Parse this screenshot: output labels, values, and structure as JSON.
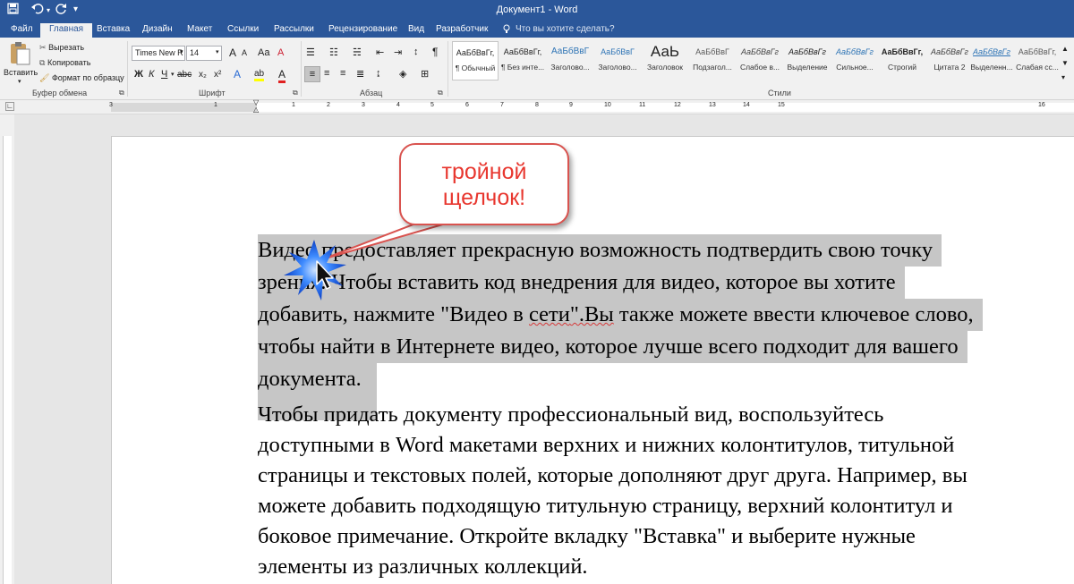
{
  "window": {
    "title": "Документ1 - Word"
  },
  "tabs": [
    "Файл",
    "Главная",
    "Вставка",
    "Дизайн",
    "Макет",
    "Ссылки",
    "Рассылки",
    "Рецензирование",
    "Вид",
    "Разработчик"
  ],
  "tell_me": "Что вы хотите сделать?",
  "clipboard": {
    "paste": "Вставить",
    "cut": "Вырезать",
    "copy": "Копировать",
    "format_painter": "Формат по образцу",
    "group": "Буфер обмена"
  },
  "font": {
    "name": "Times New R",
    "size": "14",
    "group": "Шрифт",
    "bold": "Ж",
    "italic": "К",
    "underline": "Ч",
    "strike": "abc",
    "sub": "x₂",
    "sup": "x²",
    "grow": "A",
    "shrink": "A",
    "case": "Aa",
    "clear": "A",
    "effects": "A",
    "highlight": "ab",
    "color": "A"
  },
  "paragraph": {
    "group": "Абзац",
    "pilcrow": "¶"
  },
  "styles": {
    "group": "Стили",
    "items": [
      {
        "preview": "АаБбВвГг,",
        "name": "¶ Обычный"
      },
      {
        "preview": "АаБбВвГг,",
        "name": "¶ Без инте..."
      },
      {
        "preview": "АаБбВвГ",
        "name": "Заголово..."
      },
      {
        "preview": "АаБбВвГ",
        "name": "Заголово..."
      },
      {
        "preview": "АаЬ",
        "name": "Заголовок"
      },
      {
        "preview": "АаБбВвГ",
        "name": "Подзагол..."
      },
      {
        "preview": "АаБбВвГг",
        "name": "Слабое в..."
      },
      {
        "preview": "АаБбВвГг",
        "name": "Выделение"
      },
      {
        "preview": "АаБбВвГг",
        "name": "Сильное..."
      },
      {
        "preview": "АаБбВвГг,",
        "name": "Строгий"
      },
      {
        "preview": "АаБбВвГг",
        "name": "Цитата 2"
      },
      {
        "preview": "АаБбВвГг",
        "name": "Выделенн..."
      },
      {
        "preview": "АаБбВвГг,",
        "name": "Слабая сс..."
      }
    ]
  },
  "ruler": {
    "marks": [
      "3",
      "1",
      "1",
      "2",
      "3",
      "4",
      "5",
      "6",
      "7",
      "8",
      "9",
      "10",
      "11",
      "12",
      "13",
      "14",
      "15",
      "16"
    ]
  },
  "callout": {
    "line1": "тройной",
    "line2": "щелчок!"
  },
  "doc": {
    "para1": [
      "Видео предоставляет прекрасную возможность подтвердить свою точку",
      "зрения. Чтобы вставить код внедрения для видео, которое вы хотите",
      "добавить, нажмите \"Видео в ",
      "сети",
      "\".Вы",
      " также можете ввести ключевое слово,",
      "чтобы найти в Интернете видео, которое лучше всего подходит для вашего",
      "документа."
    ],
    "para2": [
      "Чтобы придать документу профессиональный вид, воспользуйтесь",
      "доступными в Word макетами верхних и нижних колонтитулов, титульной",
      "страницы и текстовых полей, которые дополняют друг друга. Например, вы",
      "можете добавить подходящую титульную страницу, верхний колонтитул и",
      "боковое примечание. Откройте вкладку \"Вставка\" и выберите нужные",
      "элементы из различных коллекций."
    ]
  },
  "colors": {
    "accent": "#2b579a",
    "callout": "#e8372f",
    "selection": "#c6c6c6"
  }
}
